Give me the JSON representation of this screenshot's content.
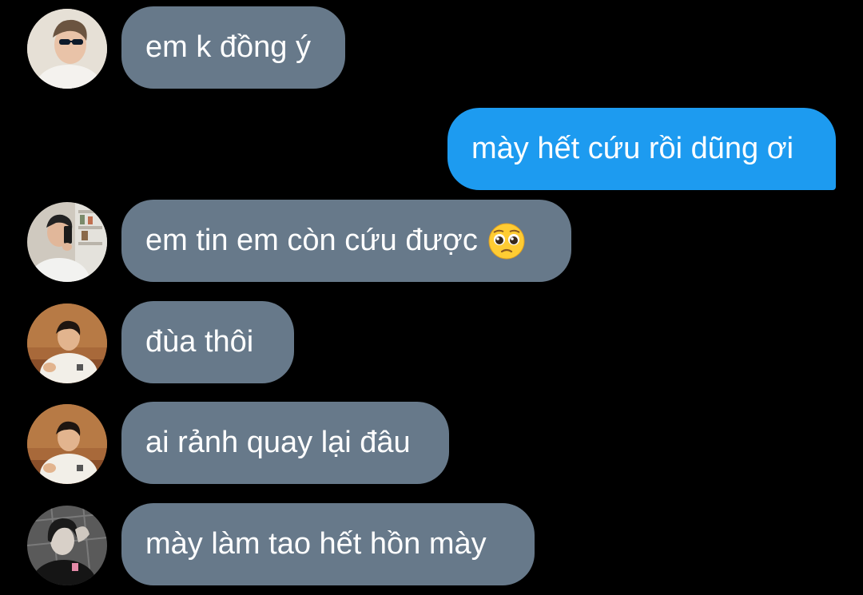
{
  "messages": [
    {
      "sender": "other",
      "text": "em k đồng ý"
    },
    {
      "sender": "self",
      "text": "mày hết cứu rồi dũng ơi"
    },
    {
      "sender": "other",
      "text": "em tin em còn cứu được",
      "emoji": "pleading-face"
    },
    {
      "sender": "other",
      "text": "đùa thôi"
    },
    {
      "sender": "other",
      "text": "ai rảnh quay lại đâu"
    },
    {
      "sender": "other",
      "text": "mày làm tao hết hồn mày"
    }
  ],
  "colors": {
    "background": "#000000",
    "incoming_bubble": "#67798a",
    "outgoing_bubble": "#1d9bf0",
    "text": "#ffffff"
  },
  "icons": {
    "avatars": [
      "avatar-sunglasses-photo",
      "avatar-mirror-selfie-photo",
      "avatar-white-shirt-photo",
      "avatar-white-shirt-photo",
      "avatar-bw-photo"
    ]
  }
}
